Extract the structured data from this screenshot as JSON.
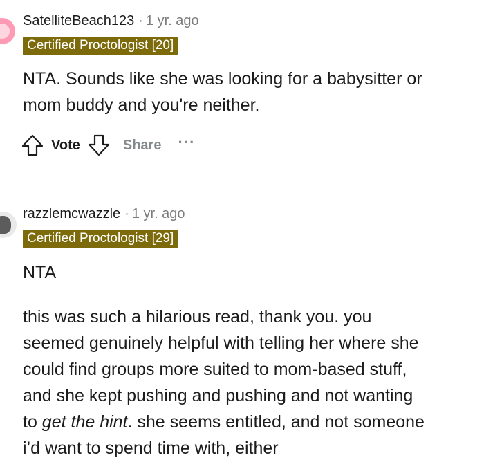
{
  "comments": [
    {
      "username": "SatelliteBeach123",
      "separator": "·",
      "time": "1 yr. ago",
      "flair": "Certified Proctologist [20]",
      "body": [
        "NTA. Sounds like she was looking for a babysitter or",
        "mom buddy and you're neither."
      ],
      "actions": {
        "vote_label": "Vote",
        "share_label": "Share",
        "more_label": "···"
      }
    },
    {
      "username": "razzlemcwazzle",
      "separator": "·",
      "time": "1 yr. ago",
      "flair": "Certified Proctologist [29]",
      "paragraph1": "NTA",
      "paragraph2": {
        "line1": "this was such a hilarious read, thank you. you",
        "line2": "seemed genuinely helpful with telling her where she",
        "line3": "could find groups more suited to mom-based stuff,",
        "line4": "and she kept pushing and pushing and not wanting",
        "line5_prefix": "to ",
        "line5_em": "get the hint",
        "line5_suffix": ". she seems entitled, and not someone",
        "line6": "i’d want to spend time with, either"
      }
    }
  ],
  "colors": {
    "flair_bg": "#7d6a0a",
    "meta_gray": "#7c7c7c",
    "action_gray": "#878a8c"
  },
  "icons": [
    "upvote-icon",
    "downvote-icon",
    "more-options-icon"
  ]
}
